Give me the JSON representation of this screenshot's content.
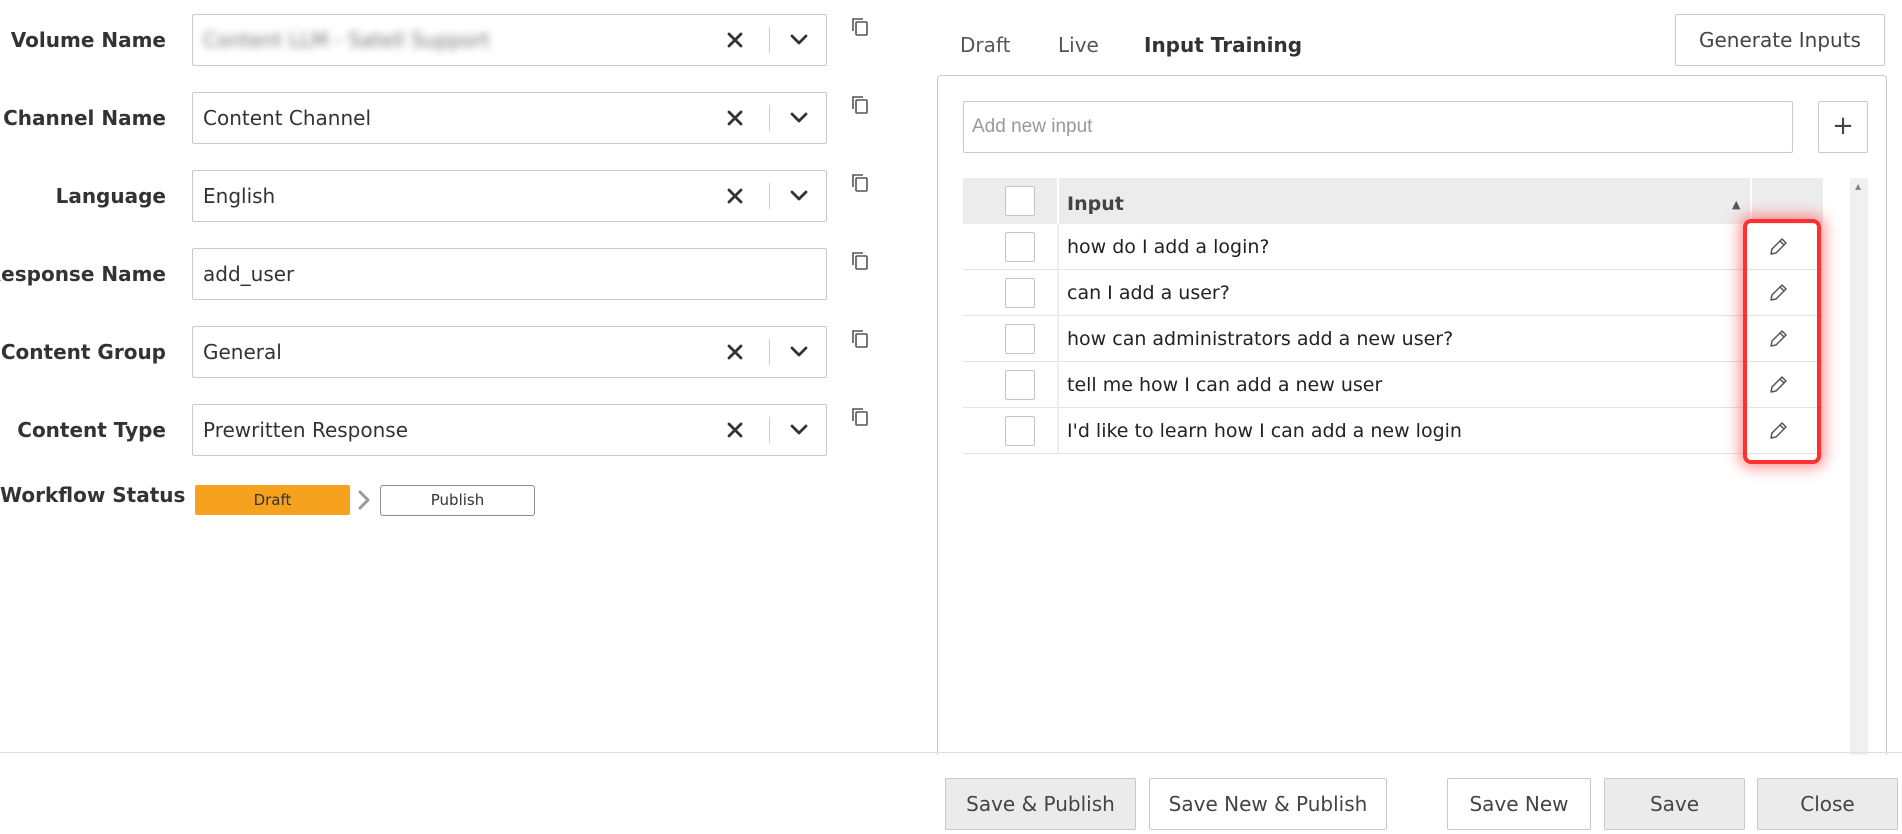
{
  "form": {
    "fields": [
      {
        "label": "Volume Name",
        "value": "Content LLM - Satell Support",
        "clearable": true,
        "dropdown": true,
        "blurred": true
      },
      {
        "label": "Channel Name",
        "value": "Content Channel",
        "clearable": true,
        "dropdown": true
      },
      {
        "label": "Language",
        "value": "English",
        "clearable": true,
        "dropdown": true
      },
      {
        "label": "Response Name",
        "value": "add_user",
        "clearable": false,
        "dropdown": false
      },
      {
        "label": "Content Group",
        "value": "General",
        "clearable": true,
        "dropdown": true
      },
      {
        "label": "Content Type",
        "value": "Prewritten Response",
        "clearable": true,
        "dropdown": true
      }
    ],
    "workflow": {
      "label": "Workflow Status",
      "current": "Draft",
      "next": "Publish",
      "current_color": "#f7a21e"
    }
  },
  "tabs": [
    {
      "label": "Draft",
      "active": false
    },
    {
      "label": "Live",
      "active": false
    },
    {
      "label": "Input Training",
      "active": true
    }
  ],
  "generate_button": "Generate Inputs",
  "add_input": {
    "placeholder": "Add new input",
    "button": "+"
  },
  "table": {
    "header": "Input",
    "sort_indicator": "▲",
    "rows": [
      "how do I add a login?",
      "can I add a user?",
      "how can administrators add a new user?",
      "tell me how I can add a new user",
      "I'd like to learn how I can add a new login"
    ]
  },
  "footer": {
    "save_publish": "Save & Publish",
    "save_new_publish": "Save New & Publish",
    "save_new": "Save New",
    "save": "Save",
    "close": "Close"
  },
  "icons": {
    "clear": "close-x-icon",
    "dropdown": "chevron-down-icon",
    "copy": "copy-icon",
    "edit": "pencil-icon",
    "workflow_arrow": "chevron-right-icon"
  },
  "colors": {
    "highlight": "#ff3030",
    "draft_badge": "#f7a21e"
  }
}
